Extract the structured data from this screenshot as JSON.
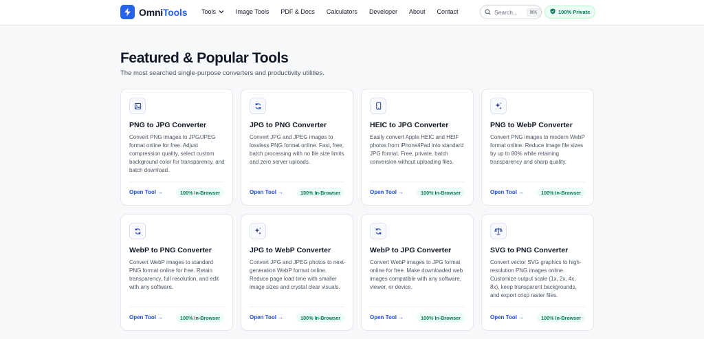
{
  "header": {
    "logo": {
      "text_main": "Omni",
      "text_accent": "Tools"
    },
    "nav": [
      {
        "label": "Tools",
        "has_dropdown": true
      },
      {
        "label": "Image Tools"
      },
      {
        "label": "PDF & Docs"
      },
      {
        "label": "Calculators"
      },
      {
        "label": "Developer"
      },
      {
        "label": "About"
      },
      {
        "label": "Contact"
      }
    ],
    "search": {
      "placeholder": "Search...",
      "shortcut": "⌘K"
    },
    "private_badge": "100% Private"
  },
  "section": {
    "title": "Featured & Popular Tools",
    "subtitle": "The most searched single-purpose converters and productivity utilities."
  },
  "cards": [
    {
      "icon": "image-icon",
      "title": "PNG to JPG Converter",
      "description": "Convert PNG images to JPG/JPEG format online for free. Adjust compression quality, select custom background color for transparency, and batch download.",
      "link": "Open Tool →",
      "badge": "100% In-Browser"
    },
    {
      "icon": "refresh-icon",
      "title": "JPG to PNG Converter",
      "description": "Convert JPG and JPEG images to lossless PNG format online. Fast, free, batch processing with no file size limits and zero server uploads.",
      "link": "Open Tool →",
      "badge": "100% In-Browser"
    },
    {
      "icon": "smartphone-icon",
      "title": "HEIC to JPG Converter",
      "description": "Easily convert Apple HEIC and HEIF photos from iPhone/iPad into standard JPG format. Free, private, batch conversion without uploading files.",
      "link": "Open Tool →",
      "badge": "100% In-Browser"
    },
    {
      "icon": "sparkles-icon",
      "title": "PNG to WebP Converter",
      "description": "Convert PNG images to modern WebP format online. Reduce image file sizes by up to 80% while retaining transparency and sharp quality.",
      "link": "Open Tool →",
      "badge": "100% In-Browser"
    },
    {
      "icon": "refresh-icon",
      "title": "WebP to PNG Converter",
      "description": "Convert WebP images to standard PNG format online for free. Retain transparency, full resolution, and edit with any software.",
      "link": "Open Tool →",
      "badge": "100% In-Browser"
    },
    {
      "icon": "sparkles-icon",
      "title": "JPG to WebP Converter",
      "description": "Convert JPG and JPEG photos to next-generation WebP format online. Reduce page load time with smaller image sizes and crystal clear visuals.",
      "link": "Open Tool →",
      "badge": "100% In-Browser"
    },
    {
      "icon": "refresh-icon",
      "title": "WebP to JPG Converter",
      "description": "Convert WebP images to JPG format online for free. Make downloaded web images compatible with any software, viewer, or device.",
      "link": "Open Tool →",
      "badge": "100% In-Browser"
    },
    {
      "icon": "scale-icon",
      "title": "SVG to PNG Converter",
      "description": "Convert vector SVG graphics to high-resolution PNG images online. Customize output scale (1x, 2x, 4x, 8x), keep transparent backgrounds, and export crisp raster files.",
      "link": "Open Tool →",
      "badge": "100% In-Browser"
    }
  ],
  "colors": {
    "accent": "#2563eb",
    "link": "#1d4ed8",
    "badge_bg": "#ecfdf5",
    "badge_text": "#047857",
    "background": "#f7f8fa"
  }
}
